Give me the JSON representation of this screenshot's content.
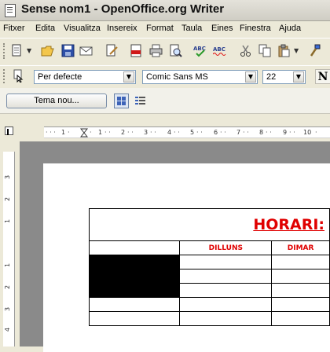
{
  "window": {
    "title": "Sense nom1 - OpenOffice.org Writer"
  },
  "menu": [
    "Fitxer",
    "Edita",
    "Visualitza",
    "Insereix",
    "Format",
    "Taula",
    "Eines",
    "Finestra",
    "Ajuda"
  ],
  "format_toolbar": {
    "style": "Per defecte",
    "font": "Comic Sans MS",
    "size": "22",
    "bold_label": "N"
  },
  "theme_toolbar": {
    "new_theme_label": "Tema nou..."
  },
  "ruler": {
    "marks": [
      "1",
      "1",
      "2",
      "3",
      "4",
      "5",
      "6",
      "7",
      "8",
      "9",
      "10"
    ],
    "vmarks": [
      "3",
      "2",
      "1",
      "1",
      "2",
      "3",
      "4"
    ]
  },
  "document": {
    "title": "HORARI:",
    "days": [
      "DILLUNS",
      "DIMAR"
    ]
  },
  "colors": {
    "title_red": "#e00000",
    "desktop_gray": "#8a8a8a"
  }
}
